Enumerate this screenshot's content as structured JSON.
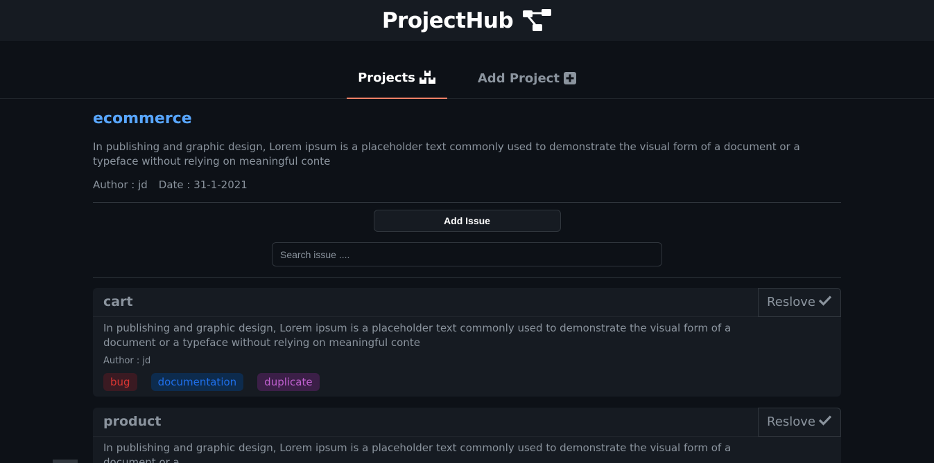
{
  "header": {
    "brand": "ProjectHub",
    "brand_icon": "network-icon"
  },
  "tabs": [
    {
      "label": "Projects",
      "icon": "boxes-icon",
      "active": true
    },
    {
      "label": "Add Project",
      "icon": "plus-square-icon",
      "active": false
    }
  ],
  "project": {
    "title": "ecommerce",
    "description": "In publishing and graphic design, Lorem ipsum is a placeholder text commonly used to demonstrate the visual form of a document or a typeface without relying on meaningful conte",
    "author": "Author : jd",
    "date": "Date : 31-1-2021"
  },
  "actions": {
    "add_issue_label": "Add Issue"
  },
  "search": {
    "placeholder": "Search issue ...."
  },
  "issues": [
    {
      "title": "cart",
      "resolve_label": "Reslove",
      "description": "In publishing and graphic design, Lorem ipsum is a placeholder text commonly used to demonstrate the visual form of a document or a typeface without relying on meaningful conte",
      "author": "Author : jd",
      "labels": [
        "bug",
        "documentation",
        "duplicate"
      ]
    },
    {
      "title": "product",
      "resolve_label": "Reslove",
      "description": "In publishing and graphic design, Lorem ipsum is a placeholder text commonly used to demonstrate the visual form of a document or a"
    }
  ],
  "colors": {
    "background": "#0d1117",
    "header": "#161b22",
    "accent_tab": "#f78166",
    "title_blue": "#58a6ff",
    "label_bug": "#da3633",
    "label_doc": "#1f6feb",
    "label_dup": "#c060d0"
  }
}
